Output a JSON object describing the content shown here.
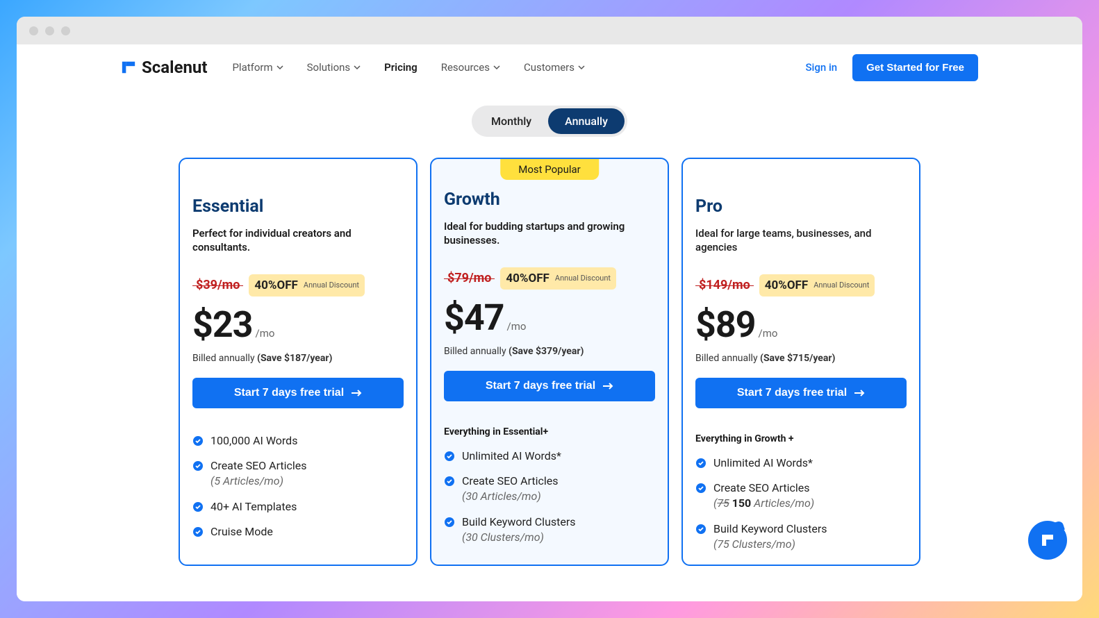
{
  "brand": "Scalenut",
  "nav": {
    "items": [
      {
        "label": "Platform",
        "dropdown": true
      },
      {
        "label": "Solutions",
        "dropdown": true
      },
      {
        "label": "Pricing",
        "dropdown": false
      },
      {
        "label": "Resources",
        "dropdown": true
      },
      {
        "label": "Customers",
        "dropdown": true
      }
    ],
    "signin": "Sign in",
    "cta": "Get Started for Free"
  },
  "toggle": {
    "monthly": "Monthly",
    "annually": "Annually"
  },
  "plans": [
    {
      "name": "Essential",
      "desc": "Perfect for individual creators and consultants.",
      "strike": "$39/mo",
      "discount_pct": "40%OFF",
      "discount_label": "Annual Discount",
      "price": "$23",
      "per": "/mo",
      "billed_prefix": "Billed annually ",
      "billed_save": "(Save $187/year)",
      "trial": "Start 7 days free trial",
      "everything": "",
      "features": [
        {
          "text": "100,000 AI Words"
        },
        {
          "text": "Create SEO Articles",
          "sub": "(5 Articles/mo)"
        },
        {
          "text": "40+ AI Templates"
        },
        {
          "text": "Cruise Mode"
        }
      ]
    },
    {
      "name": "Growth",
      "badge": "Most Popular",
      "desc": "Ideal for budding startups and growing businesses.",
      "strike": "$79/mo",
      "discount_pct": "40%OFF",
      "discount_label": "Annual Discount",
      "price": "$47",
      "per": "/mo",
      "billed_prefix": "Billed annually ",
      "billed_save": "(Save $379/year)",
      "trial": "Start 7 days free trial",
      "everything": "Everything in Essential+",
      "features": [
        {
          "text": "Unlimited AI Words*"
        },
        {
          "text": "Create SEO Articles",
          "sub": "(30 Articles/mo)"
        },
        {
          "text": "Build Keyword Clusters",
          "sub": "(30 Clusters/mo)"
        }
      ]
    },
    {
      "name": "Pro",
      "desc": "Ideal for large teams, businesses, and agencies",
      "strike": "$149/mo",
      "discount_pct": "40%OFF",
      "discount_label": "Annual Discount",
      "price": "$89",
      "per": "/mo",
      "billed_prefix": "Billed annually ",
      "billed_save": "(Save $715/year)",
      "trial": "Start 7 days free trial",
      "everything": "Everything in Growth +",
      "features": [
        {
          "text": "Unlimited AI Words*"
        },
        {
          "text": "Create SEO Articles",
          "strike_sub": "75",
          "bold_sub": "150",
          "tail_sub": " Articles/mo)"
        },
        {
          "text": "Build Keyword Clusters",
          "sub": "(75 Clusters/mo)"
        }
      ]
    }
  ]
}
